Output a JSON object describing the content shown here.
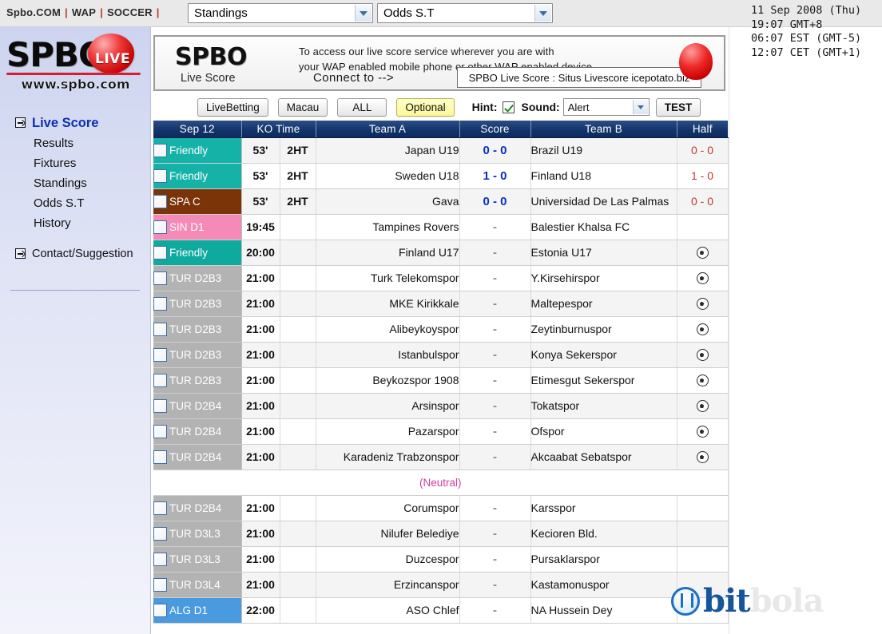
{
  "topbar": {
    "links": [
      {
        "label": "Spbo.COM"
      },
      {
        "label": "WAP"
      },
      {
        "label": "SOCCER"
      }
    ],
    "separator": "|",
    "view_select": {
      "value": "Standings",
      "icon": "chevron-down-icon"
    },
    "league_select": {
      "value": "Odds S.T",
      "icon": "chevron-down-icon"
    }
  },
  "clock": {
    "date": "11 Sep 2008 (Thu)",
    "line2": "19:07 GMT+8",
    "line3": "06:07 EST (GMT-5)",
    "line4": "12:07 CET (GMT+1)"
  },
  "sidebar": {
    "logo_main": "SPBO",
    "logo_badge": "LIVE",
    "logo_url": "www.spbo.com",
    "items": [
      {
        "label": "Live Score",
        "active": true,
        "icon": "arrow-right-box-icon"
      },
      {
        "label": "Results",
        "active": false,
        "icon": ""
      },
      {
        "label": "Fixtures",
        "active": false,
        "icon": ""
      },
      {
        "label": "Standings",
        "active": false,
        "icon": ""
      },
      {
        "label": "Odds S.T",
        "active": false,
        "icon": ""
      },
      {
        "label": "History",
        "active": false,
        "icon": ""
      }
    ],
    "contact": {
      "label": "Contact/Suggestion",
      "icon": "arrow-right-box-icon"
    }
  },
  "banner": {
    "brand": "SPBO",
    "brand_sub": "Live Score",
    "text_line1": "To access our live score service wherever you are with",
    "text_line2": "your WAP enabled mobile phone or other WAP enabled device,",
    "connect_label": "Connect to -->",
    "url_text": "SPBO Live Score : Situs Livescore icepotato.biz"
  },
  "toolbar": {
    "livebetting": "LiveBetting",
    "macau": "Macau",
    "all": "ALL",
    "optional": "Optional",
    "hint_label": "Hint:",
    "hint_checked": true,
    "sound_label": "Sound:",
    "sound_value": "Alert",
    "test": "TEST"
  },
  "table": {
    "headers": {
      "date": "Sep 12",
      "ko_time": "KO Time",
      "team_a": "Team A",
      "score": "Score",
      "team_b": "Team B",
      "half": "Half"
    },
    "rows": [
      {
        "type": "match",
        "league": "Friendly",
        "league_color": "#15b2a8",
        "league_text": "#ffffff",
        "minute": "53'",
        "ht": "2HT",
        "team_a": "Japan U19",
        "score": "0 - 0",
        "live": true,
        "team_b": "Brazil U19",
        "half": "0 - 0",
        "half_icon": ""
      },
      {
        "type": "match",
        "league": "Friendly",
        "league_color": "#15b2a8",
        "league_text": "#ffffff",
        "minute": "53'",
        "ht": "2HT",
        "team_a": "Sweden U18",
        "score": "1 - 0",
        "live": true,
        "team_b": "Finland U18",
        "half": "1 - 0",
        "half_icon": ""
      },
      {
        "type": "match",
        "league": "SPA C",
        "league_color": "#7a3408",
        "league_text": "#ffffff",
        "minute": "53'",
        "ht": "2HT",
        "team_a": "Gava",
        "score": "0 - 0",
        "live": true,
        "team_b": "Universidad De Las Palmas",
        "half": "0 - 0",
        "half_icon": ""
      },
      {
        "type": "match",
        "league": "SIN D1",
        "league_color": "#f58ab8",
        "league_text": "#ffffff",
        "minute": "19:45",
        "ht": "",
        "team_a": "Tampines Rovers",
        "score": "-",
        "live": false,
        "team_b": "Balestier Khalsa FC",
        "half": "",
        "half_icon": ""
      },
      {
        "type": "match",
        "league": "Friendly",
        "league_color": "#0eaa9e",
        "league_text": "#ffffff",
        "minute": "20:00",
        "ht": "",
        "team_a": "Finland U17",
        "score": "-",
        "live": false,
        "team_b": "Estonia U17",
        "half": "",
        "half_icon": "soccer-ball-icon"
      },
      {
        "type": "match",
        "league": "TUR D2B3",
        "league_color": "#b3b3b3",
        "league_text": "#ffffff",
        "minute": "21:00",
        "ht": "",
        "team_a": "Turk Telekomspor",
        "score": "-",
        "live": false,
        "team_b": "Y.Kirsehirspor",
        "half": "",
        "half_icon": "soccer-ball-icon"
      },
      {
        "type": "match",
        "league": "TUR D2B3",
        "league_color": "#b3b3b3",
        "league_text": "#ffffff",
        "minute": "21:00",
        "ht": "",
        "team_a": "MKE Kirikkale",
        "score": "-",
        "live": false,
        "team_b": "Maltepespor",
        "half": "",
        "half_icon": "soccer-ball-icon"
      },
      {
        "type": "match",
        "league": "TUR D2B3",
        "league_color": "#b3b3b3",
        "league_text": "#ffffff",
        "minute": "21:00",
        "ht": "",
        "team_a": "Alibeykoyspor",
        "score": "-",
        "live": false,
        "team_b": "Zeytinburnuspor",
        "half": "",
        "half_icon": "soccer-ball-icon"
      },
      {
        "type": "match",
        "league": "TUR D2B3",
        "league_color": "#b3b3b3",
        "league_text": "#ffffff",
        "minute": "21:00",
        "ht": "",
        "team_a": "Istanbulspor",
        "score": "-",
        "live": false,
        "team_b": "Konya Sekerspor",
        "half": "",
        "half_icon": "soccer-ball-icon"
      },
      {
        "type": "match",
        "league": "TUR D2B3",
        "league_color": "#b3b3b3",
        "league_text": "#ffffff",
        "minute": "21:00",
        "ht": "",
        "team_a": "Beykozspor 1908",
        "score": "-",
        "live": false,
        "team_b": "Etimesgut Sekerspor",
        "half": "",
        "half_icon": "soccer-ball-icon"
      },
      {
        "type": "match",
        "league": "TUR D2B4",
        "league_color": "#b3b3b3",
        "league_text": "#ffffff",
        "minute": "21:00",
        "ht": "",
        "team_a": "Arsinspor",
        "score": "-",
        "live": false,
        "team_b": "Tokatspor",
        "half": "",
        "half_icon": "soccer-ball-icon"
      },
      {
        "type": "match",
        "league": "TUR D2B4",
        "league_color": "#b3b3b3",
        "league_text": "#ffffff",
        "minute": "21:00",
        "ht": "",
        "team_a": "Pazarspor",
        "score": "-",
        "live": false,
        "team_b": "Ofspor",
        "half": "",
        "half_icon": "soccer-ball-icon"
      },
      {
        "type": "match",
        "league": "TUR D2B4",
        "league_color": "#b3b3b3",
        "league_text": "#ffffff",
        "minute": "21:00",
        "ht": "",
        "team_a": "Karadeniz Trabzonspor",
        "score": "-",
        "live": false,
        "team_b": "Akcaabat Sebatspor",
        "half": "",
        "half_icon": "soccer-ball-icon"
      },
      {
        "type": "note",
        "text": "(Neutral)"
      },
      {
        "type": "match",
        "league": "TUR D2B4",
        "league_color": "#b3b3b3",
        "league_text": "#ffffff",
        "minute": "21:00",
        "ht": "",
        "team_a": "Corumspor",
        "score": "-",
        "live": false,
        "team_b": "Karsspor",
        "half": "",
        "half_icon": ""
      },
      {
        "type": "match",
        "league": "TUR D3L3",
        "league_color": "#b3b3b3",
        "league_text": "#ffffff",
        "minute": "21:00",
        "ht": "",
        "team_a": "Nilufer Belediye",
        "score": "-",
        "live": false,
        "team_b": "Kecioren Bld.",
        "half": "",
        "half_icon": ""
      },
      {
        "type": "match",
        "league": "TUR D3L3",
        "league_color": "#b3b3b3",
        "league_text": "#ffffff",
        "minute": "21:00",
        "ht": "",
        "team_a": "Duzcespor",
        "score": "-",
        "live": false,
        "team_b": "Pursaklarspor",
        "half": "",
        "half_icon": ""
      },
      {
        "type": "match",
        "league": "TUR D3L4",
        "league_color": "#b3b3b3",
        "league_text": "#ffffff",
        "minute": "21:00",
        "ht": "",
        "team_a": "Erzincanspor",
        "score": "-",
        "live": false,
        "team_b": "Kastamonuspor",
        "half": "",
        "half_icon": ""
      },
      {
        "type": "match",
        "league": "ALG D1",
        "league_color": "#4a9ae0",
        "league_text": "#ffffff",
        "minute": "22:00",
        "ht": "",
        "team_a": "ASO Chlef",
        "score": "-",
        "live": false,
        "team_b": "NA Hussein Dey",
        "half": "",
        "half_icon": ""
      }
    ]
  },
  "watermark": {
    "part1": "bit",
    "part2": "bola",
    "icon": "bitbola-logo-icon"
  }
}
